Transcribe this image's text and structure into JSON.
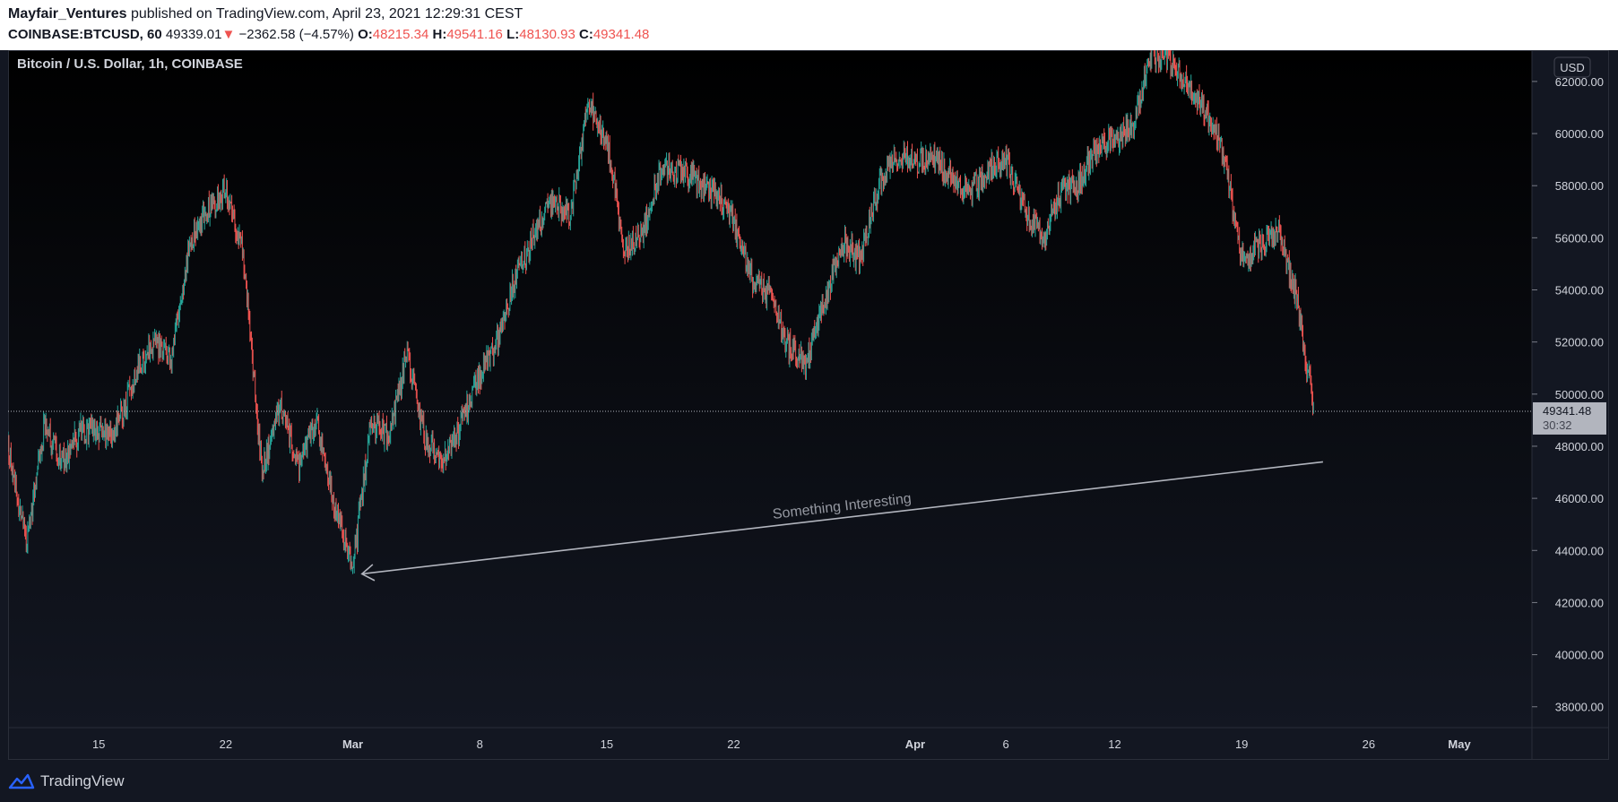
{
  "header": {
    "author": "Mayfair_Ventures",
    "published": "published on TradingView.com, April 23, 2021 12:29:31 CEST",
    "symbol": "COINBASE:BTCUSD, 60",
    "price": "49339.01",
    "change_arrow": "▼",
    "change": "−2362.58 (−4.57%)",
    "open_label": "O:",
    "open": "48215.34",
    "high_label": "H:",
    "high": "49541.16",
    "low_label": "L:",
    "low": "48130.93",
    "close_label": "C:",
    "close": "49341.48"
  },
  "footer": {
    "brand": "TradingView"
  },
  "colors": {
    "up": "#26a69a",
    "down": "#ef5350",
    "background": "#0c0d12",
    "annotation": "#b2b5be"
  },
  "chart_data": {
    "type": "candlestick",
    "title": "Bitcoin / U.S. Dollar, 1h, COINBASE",
    "currency": "USD",
    "interval": "1h",
    "ylim": [
      37200,
      63200
    ],
    "y_ticks": [
      {
        "value": 62000,
        "label": "62000.00"
      },
      {
        "value": 60000,
        "label": "60000.00"
      },
      {
        "value": 58000,
        "label": "58000.00"
      },
      {
        "value": 56000,
        "label": "56000.00"
      },
      {
        "value": 54000,
        "label": "54000.00"
      },
      {
        "value": 52000,
        "label": "52000.00"
      },
      {
        "value": 50000,
        "label": "50000.00"
      },
      {
        "value": 48000,
        "label": "48000.00"
      },
      {
        "value": 46000,
        "label": "46000.00"
      },
      {
        "value": 44000,
        "label": "44000.00"
      },
      {
        "value": 42000,
        "label": "42000.00"
      },
      {
        "value": 40000,
        "label": "40000.00"
      },
      {
        "value": 38000,
        "label": "38000.00"
      }
    ],
    "x_range_days": [
      "2021-02-10",
      "2021-05-05"
    ],
    "x_ticks": [
      {
        "date": "2021-02-15",
        "label": "15",
        "bold": false
      },
      {
        "date": "2021-02-22",
        "label": "22",
        "bold": false
      },
      {
        "date": "2021-03-01",
        "label": "Mar",
        "bold": true
      },
      {
        "date": "2021-03-08",
        "label": "8",
        "bold": false
      },
      {
        "date": "2021-03-15",
        "label": "15",
        "bold": false
      },
      {
        "date": "2021-03-22",
        "label": "22",
        "bold": false
      },
      {
        "date": "2021-04-01",
        "label": "Apr",
        "bold": true
      },
      {
        "date": "2021-04-06",
        "label": "6",
        "bold": false
      },
      {
        "date": "2021-04-12",
        "label": "12",
        "bold": false
      },
      {
        "date": "2021-04-19",
        "label": "19",
        "bold": false
      },
      {
        "date": "2021-04-26",
        "label": "26",
        "bold": false
      },
      {
        "date": "2021-05-01",
        "label": "May",
        "bold": true
      }
    ],
    "price_path": [
      [
        "2021-02-10",
        48000
      ],
      [
        "2021-02-11",
        44200
      ],
      [
        "2021-02-12",
        48800
      ],
      [
        "2021-02-13",
        47400
      ],
      [
        "2021-02-14",
        48600
      ],
      [
        "2021-02-15",
        48500
      ],
      [
        "2021-02-16",
        48700
      ],
      [
        "2021-02-17",
        50600
      ],
      [
        "2021-02-18",
        52100
      ],
      [
        "2021-02-19",
        51400
      ],
      [
        "2021-02-20",
        55800
      ],
      [
        "2021-02-21",
        57000
      ],
      [
        "2021-02-22",
        57800
      ],
      [
        "2021-02-23",
        55200
      ],
      [
        "2021-02-24",
        47000
      ],
      [
        "2021-02-25",
        49600
      ],
      [
        "2021-02-26",
        47100
      ],
      [
        "2021-02-27",
        49000
      ],
      [
        "2021-02-28",
        45700
      ],
      [
        "2021-03-01",
        43200
      ],
      [
        "2021-03-02",
        48900
      ],
      [
        "2021-03-03",
        48400
      ],
      [
        "2021-03-04",
        51600
      ],
      [
        "2021-03-05",
        48200
      ],
      [
        "2021-03-06",
        47400
      ],
      [
        "2021-03-07",
        48900
      ],
      [
        "2021-03-08",
        50700
      ],
      [
        "2021-03-09",
        52200
      ],
      [
        "2021-03-10",
        54500
      ],
      [
        "2021-03-11",
        56100
      ],
      [
        "2021-03-12",
        57400
      ],
      [
        "2021-03-13",
        56900
      ],
      [
        "2021-03-14",
        61200
      ],
      [
        "2021-03-15",
        59800
      ],
      [
        "2021-03-16",
        55400
      ],
      [
        "2021-03-17",
        56200
      ],
      [
        "2021-03-18",
        58800
      ],
      [
        "2021-03-19",
        58600
      ],
      [
        "2021-03-20",
        58200
      ],
      [
        "2021-03-21",
        57600
      ],
      [
        "2021-03-22",
        56700
      ],
      [
        "2021-03-23",
        54400
      ],
      [
        "2021-03-24",
        53800
      ],
      [
        "2021-03-25",
        51800
      ],
      [
        "2021-03-26",
        51200
      ],
      [
        "2021-03-27",
        53600
      ],
      [
        "2021-03-28",
        55800
      ],
      [
        "2021-03-29",
        55200
      ],
      [
        "2021-03-30",
        58000
      ],
      [
        "2021-03-31",
        59200
      ],
      [
        "2021-04-01",
        58900
      ],
      [
        "2021-04-02",
        59100
      ],
      [
        "2021-04-03",
        58300
      ],
      [
        "2021-04-04",
        57800
      ],
      [
        "2021-04-05",
        58600
      ],
      [
        "2021-04-06",
        59000
      ],
      [
        "2021-04-07",
        57200
      ],
      [
        "2021-04-08",
        55900
      ],
      [
        "2021-04-09",
        57700
      ],
      [
        "2021-04-10",
        58100
      ],
      [
        "2021-04-11",
        59500
      ],
      [
        "2021-04-12",
        59700
      ],
      [
        "2021-04-13",
        60300
      ],
      [
        "2021-04-14",
        63000
      ],
      [
        "2021-04-15",
        62800
      ],
      [
        "2021-04-16",
        61800
      ],
      [
        "2021-04-17",
        60900
      ],
      [
        "2021-04-18",
        59200
      ],
      [
        "2021-04-19",
        55200
      ],
      [
        "2021-04-20",
        55700
      ],
      [
        "2021-04-21",
        56300
      ],
      [
        "2021-04-22",
        53800
      ],
      [
        "2021-04-23",
        49341
      ]
    ],
    "last_price": {
      "value": 49341.48,
      "label": "49341.48",
      "countdown": "30:32"
    },
    "annotations": [
      {
        "type": "arrow",
        "text": "Something Interesting",
        "from": [
          "2021-04-22",
          47400
        ],
        "to": [
          "2021-03-02",
          43100
        ]
      }
    ]
  }
}
